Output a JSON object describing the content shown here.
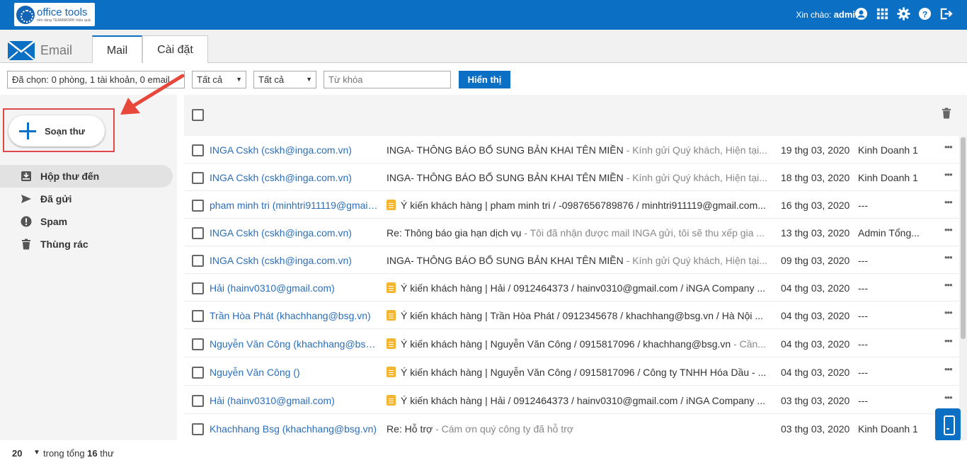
{
  "topbar": {
    "logo_title": "office tools",
    "logo_subtitle": "nền tảng TEAMWORK hiệu quả",
    "greeting": "Xin chào:",
    "username": "admin",
    "icons": [
      "user-circle-icon",
      "apps-grid-icon",
      "gear-icon",
      "help-icon",
      "logout-icon"
    ]
  },
  "header": {
    "brand": "Email",
    "tabs": [
      {
        "label": "Mail",
        "active": true
      },
      {
        "label": "Cài đặt",
        "active": false
      }
    ]
  },
  "filter": {
    "selected": "Đã chọn: 0 phòng, 1 tài khoản, 0 email",
    "select1": "Tất cả",
    "select2": "Tất cả",
    "keyword_placeholder": "Từ khóa",
    "show_button": "Hiển thị"
  },
  "sidebar": {
    "compose": "Soạn thư",
    "folders": [
      {
        "label": "Hộp thư đến",
        "icon": "inbox-icon",
        "active": true
      },
      {
        "label": "Đã gửi",
        "icon": "send-icon",
        "active": false
      },
      {
        "label": "Spam",
        "icon": "spam-icon",
        "active": false
      },
      {
        "label": "Thùng rác",
        "icon": "trash-icon",
        "active": false
      }
    ]
  },
  "mails": [
    {
      "sender": "INGA Cskh (cskh@inga.com.vn)",
      "note": false,
      "subject": "INGA- THÔNG BÁO BỔ SUNG BẢN KHAI TÊN MIỀN",
      "preview": " - Kính gửi Quý khách, Hiện tại...",
      "date": "19 thg 03, 2020",
      "dept": "Kinh Doanh 1"
    },
    {
      "sender": "INGA Cskh (cskh@inga.com.vn)",
      "note": false,
      "subject": "INGA- THÔNG BÁO BỔ SUNG BẢN KHAI TÊN MIỀN",
      "preview": " - Kính gửi Quý khách, Hiện tại...",
      "date": "18 thg 03, 2020",
      "dept": "Kinh Doanh 1"
    },
    {
      "sender": "pham minh tri (minhtri911119@gmail.com)",
      "note": true,
      "subject": "Ý kiến khách hàng | pham minh tri / -0987656789876 / minhtri911119@gmail.com...",
      "preview": "",
      "date": "16 thg 03, 2020",
      "dept": "---"
    },
    {
      "sender": "INGA Cskh (cskh@inga.com.vn)",
      "note": false,
      "subject": "Re: Thông báo gia hạn dịch vụ",
      "preview": " - Tôi đã nhận được mail INGA gửi, tôi sẽ thu xếp gia ...",
      "date": "13 thg 03, 2020",
      "dept": "Admin Tổng..."
    },
    {
      "sender": "INGA Cskh (cskh@inga.com.vn)",
      "note": false,
      "subject": "INGA- THÔNG BÁO BỔ SUNG BẢN KHAI TÊN MIỀN",
      "preview": " - Kính gửi Quý khách, Hiện tại...",
      "date": "09 thg 03, 2020",
      "dept": "---"
    },
    {
      "sender": "Hải (hainv0310@gmail.com)",
      "note": true,
      "subject": "Ý kiến khách hàng | Hải / 0912464373 / hainv0310@gmail.com / iNGA Company ...",
      "preview": "",
      "date": "04 thg 03, 2020",
      "dept": "---"
    },
    {
      "sender": "Trần Hòa Phát (khachhang@bsg.vn)",
      "note": true,
      "subject": "Ý kiến khách hàng | Trần Hòa Phát / 0912345678 / khachhang@bsg.vn / Hà Nội ...",
      "preview": "",
      "date": "04 thg 03, 2020",
      "dept": "---"
    },
    {
      "sender": "Nguyễn Văn Công (khachhang@bsg.vn)",
      "note": true,
      "subject": "Ý kiến khách hàng | Nguyễn Văn Công / 0915817096 / khachhang@bsg.vn",
      "preview": " - Cần...",
      "date": "04 thg 03, 2020",
      "dept": "---"
    },
    {
      "sender": "Nguyễn Văn Công ()",
      "note": true,
      "subject": "Ý kiến khách hàng | Nguyễn Văn Công / 0915817096 / Công ty TNHH Hóa Dầu - ...",
      "preview": "",
      "date": "04 thg 03, 2020",
      "dept": "---"
    },
    {
      "sender": "Hải (hainv0310@gmail.com)",
      "note": true,
      "subject": "Ý kiến khách hàng | Hải / 0912464373 / hainv0310@gmail.com / iNGA Company ...",
      "preview": "",
      "date": "03 thg 03, 2020",
      "dept": "---"
    },
    {
      "sender": "Khachhang Bsg (khachhang@bsg.vn)",
      "note": false,
      "subject": "Re: Hỗ trợ",
      "preview": " - Cám ơn quý công ty đã hỗ trợ",
      "date": "03 thg 03, 2020",
      "dept": "Kinh Doanh 1"
    }
  ],
  "footer": {
    "page_size": "20",
    "total_prefix": "trong tổng",
    "total_count": "16",
    "total_suffix": "thư"
  },
  "colors": {
    "primary": "#0b6fc4",
    "highlight": "#e04848",
    "note": "#f2b632",
    "sender_link": "#2a6ebb"
  }
}
